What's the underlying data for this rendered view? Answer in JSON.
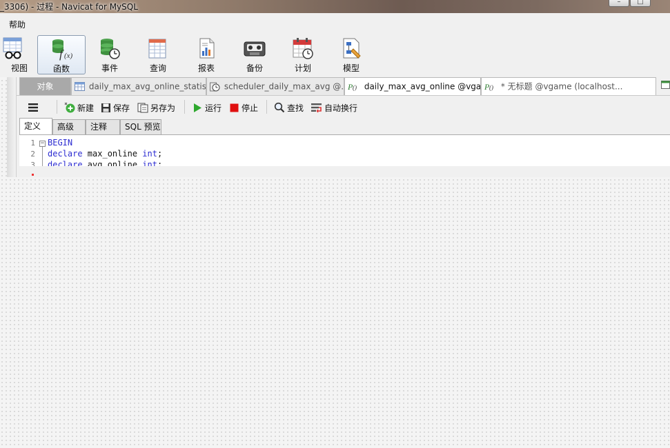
{
  "window": {
    "title": "_3306) - 过程 - Navicat for MySQL"
  },
  "menu": {
    "items": [
      "帮助"
    ]
  },
  "toolbar": {
    "items": [
      {
        "label": "视图",
        "icon": "view-icon"
      },
      {
        "label": "函数",
        "icon": "function-icon",
        "active": true
      },
      {
        "label": "事件",
        "icon": "event-icon"
      },
      {
        "label": "查询",
        "icon": "query-icon"
      },
      {
        "label": "报表",
        "icon": "report-icon"
      },
      {
        "label": "备份",
        "icon": "backup-icon"
      },
      {
        "label": "计划",
        "icon": "schedule-icon"
      },
      {
        "label": "模型",
        "icon": "model-icon"
      }
    ]
  },
  "tabs": {
    "objects": "对象",
    "items": [
      {
        "label": "daily_max_avg_online_statist...",
        "icon": "table-icon"
      },
      {
        "label": "scheduler_daily_max_avg @...",
        "icon": "event-clock-icon"
      },
      {
        "label": "daily_max_avg_online @vga...",
        "icon": "procedure-icon",
        "active": true
      },
      {
        "label": "* 无标题 @vgame (localhost...",
        "icon": "procedure-icon"
      }
    ]
  },
  "editor_toolbar": {
    "new": "新建",
    "save": "保存",
    "save_as": "另存为",
    "run": "运行",
    "stop": "停止",
    "find": "查找",
    "wrap": "自动换行"
  },
  "sub_tabs": [
    "定义",
    "高级",
    "注释",
    "SQL 预览"
  ],
  "code": {
    "lines": [
      {
        "num": "1",
        "text": "BEGIN"
      },
      {
        "num": "2",
        "text": "declare max_online int;"
      },
      {
        "num": "3",
        "text": "declare avg_online int;"
      }
    ]
  },
  "colors": {
    "keyword": "#2b2bd1",
    "run": "#2ea82e",
    "stop": "#e01010"
  }
}
